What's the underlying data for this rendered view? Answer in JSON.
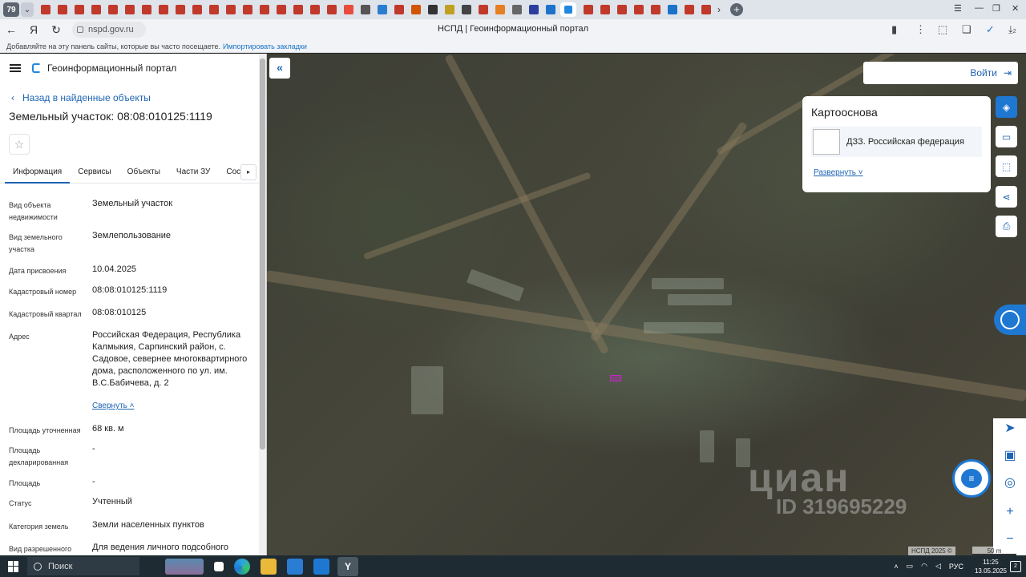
{
  "browser": {
    "tab_count": "79",
    "page_title": "НСПД | Геоинформационный портал",
    "url": "nspd.gov.ru",
    "bookmarks_hint": "Добавляйте на эту панель сайты, которые вы часто посещаете.",
    "bookmarks_import": "Импортировать закладки",
    "status_badge": "2"
  },
  "panel": {
    "portal_name": "Геоинформационный портал",
    "back_link": "Назад в найденные объекты",
    "object_title": "Земельный участок: 08:08:010125:1119",
    "tabs": [
      {
        "label": "Информация"
      },
      {
        "label": "Сервисы"
      },
      {
        "label": "Объекты"
      },
      {
        "label": "Части ЗУ"
      },
      {
        "label": "Соста"
      }
    ],
    "props": [
      {
        "key": "Вид объекта недвижимости",
        "value": "Земельный участок"
      },
      {
        "key": "Вид земельного участка",
        "value": "Землепользование"
      },
      {
        "key": "Дата присвоения",
        "value": "10.04.2025"
      },
      {
        "key": "Кадастровый номер",
        "value": "08:08:010125:1119"
      },
      {
        "key": "Кадастровый квартал",
        "value": "08:08:010125"
      },
      {
        "key": "Адрес",
        "value": "Российская Федерация, Республика Калмыкия, Сарпинский район, с. Садовое, севернее многоквартирного дома, расположенного по ул. им. В.С.Бабичева, д. 2"
      },
      {
        "key": "Площадь уточненная",
        "value": "68 кв. м"
      },
      {
        "key": "Площадь декларированная",
        "value": "-"
      },
      {
        "key": "Площадь",
        "value": "-"
      },
      {
        "key": "Статус",
        "value": "Учтенный"
      },
      {
        "key": "Категория земель",
        "value": "Земли населенных пунктов"
      },
      {
        "key": "Вид разрешенного",
        "value": "Для ведения личного подсобного"
      }
    ],
    "collapse_link": "Свернуть"
  },
  "map": {
    "login": "Войти",
    "basemap_title": "Картооснова",
    "basemap_item": "ДЗЗ. Российская федерация",
    "basemap_expand": "Развернуть",
    "attribution": "НСПД 2025 ©",
    "scale": "50 m",
    "watermark_brand": "циан",
    "watermark_id": "ID 319695229"
  },
  "taskbar": {
    "search": "Поиск",
    "lang": "РУС",
    "time": "11:25",
    "date": "13.05.2025",
    "notifications": "2"
  },
  "colors": {
    "accent": "#1e78d2",
    "link": "#1e64b4",
    "parcel": "#c326c3"
  }
}
